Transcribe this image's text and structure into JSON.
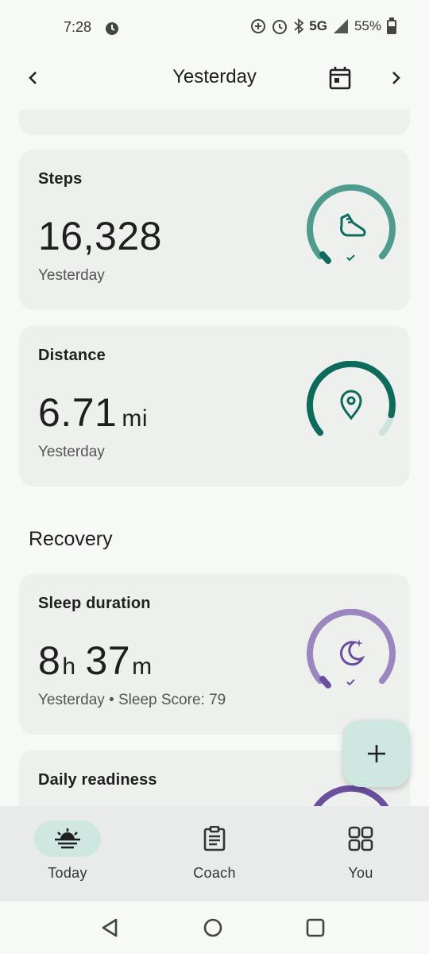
{
  "status": {
    "time": "7:28",
    "network": "5G",
    "battery": "55%"
  },
  "header": {
    "title": "Yesterday"
  },
  "cards": {
    "steps": {
      "label": "Steps",
      "value": "16,328",
      "sub": "Yesterday",
      "progress": 0.78
    },
    "distance": {
      "label": "Distance",
      "value": "6.71",
      "unit": "mi",
      "sub": "Yesterday",
      "progress": 0.72
    },
    "sleep": {
      "label": "Sleep duration",
      "hours": "8",
      "h_unit": "h",
      "minutes": "37",
      "m_unit": "m",
      "sub": "Yesterday • Sleep Score: 79",
      "progress": 0.78
    },
    "readiness": {
      "label": "Daily readiness"
    }
  },
  "sections": {
    "recovery": "Recovery"
  },
  "bottom_nav": {
    "today": "Today",
    "coach": "Coach",
    "you": "You"
  },
  "colors": {
    "steps_ring": "#4f9c8f",
    "distance_ring": "#0e6b5c",
    "sleep_ring": "#9b86c0",
    "accent_bg": "#cfe7e1"
  },
  "icons": [
    "alarm-icon",
    "shoe-icon",
    "location-pin-icon",
    "moon-stars-icon",
    "calendar-icon",
    "plus-icon"
  ]
}
